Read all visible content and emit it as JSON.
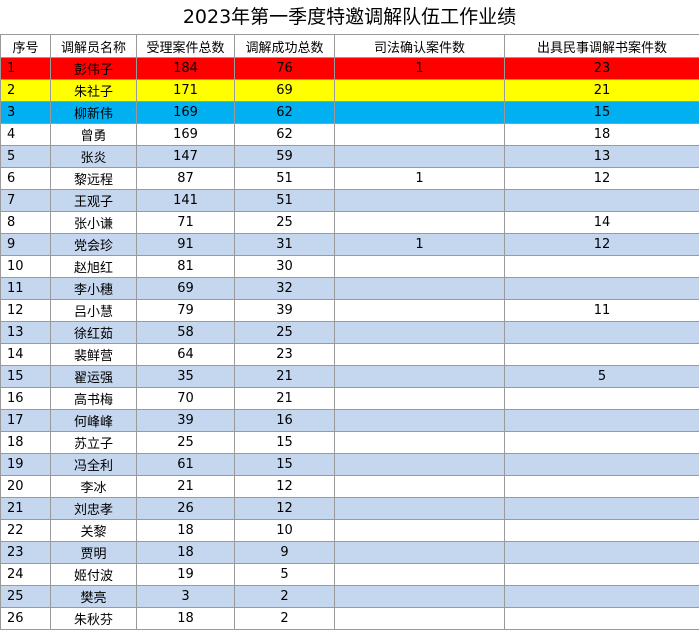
{
  "title": "2023年第一季度特邀调解队伍工作业绩",
  "colors": {
    "rank1": "#ff0000",
    "rank2": "#ffff00",
    "rank3": "#00b0f0",
    "band": "#c5d6ef",
    "plain": "#ffffff",
    "grid": "#9a9a9a"
  },
  "headers": [
    "序号",
    "调解员名称",
    "受理案件总数",
    "调解成功总数",
    "司法确认案件数",
    "出具民事调解书案件数"
  ],
  "rows": [
    {
      "no": "1",
      "name": "彭伟子",
      "accepted": "184",
      "success": "76",
      "judicial": "1",
      "documents": "23",
      "highlight": "rank1"
    },
    {
      "no": "2",
      "name": "朱社子",
      "accepted": "171",
      "success": "69",
      "judicial": "",
      "documents": "21",
      "highlight": "rank2"
    },
    {
      "no": "3",
      "name": "柳新伟",
      "accepted": "169",
      "success": "62",
      "judicial": "",
      "documents": "15",
      "highlight": "rank3"
    },
    {
      "no": "4",
      "name": "曾勇",
      "accepted": "169",
      "success": "62",
      "judicial": "",
      "documents": "18",
      "highlight": "plain"
    },
    {
      "no": "5",
      "name": "张炎",
      "accepted": "147",
      "success": "59",
      "judicial": "",
      "documents": "13",
      "highlight": "band"
    },
    {
      "no": "6",
      "name": "黎远程",
      "accepted": "87",
      "success": "51",
      "judicial": "1",
      "documents": "12",
      "highlight": "plain"
    },
    {
      "no": "7",
      "name": "王观子",
      "accepted": "141",
      "success": "51",
      "judicial": "",
      "documents": "",
      "highlight": "band"
    },
    {
      "no": "8",
      "name": "张小谦",
      "accepted": "71",
      "success": "25",
      "judicial": "",
      "documents": "14",
      "highlight": "plain"
    },
    {
      "no": "9",
      "name": "党会珍",
      "accepted": "91",
      "success": "31",
      "judicial": "1",
      "documents": "12",
      "highlight": "band"
    },
    {
      "no": "10",
      "name": "赵旭红",
      "accepted": "81",
      "success": "30",
      "judicial": "",
      "documents": "",
      "highlight": "plain"
    },
    {
      "no": "11",
      "name": "李小穗",
      "accepted": "69",
      "success": "32",
      "judicial": "",
      "documents": "",
      "highlight": "band"
    },
    {
      "no": "12",
      "name": "吕小慧",
      "accepted": "79",
      "success": "39",
      "judicial": "",
      "documents": "11",
      "highlight": "plain"
    },
    {
      "no": "13",
      "name": "徐红茹",
      "accepted": "58",
      "success": "25",
      "judicial": "",
      "documents": "",
      "highlight": "band"
    },
    {
      "no": "14",
      "name": "裴鲜营",
      "accepted": "64",
      "success": "23",
      "judicial": "",
      "documents": "",
      "highlight": "plain"
    },
    {
      "no": "15",
      "name": "翟运强",
      "accepted": "35",
      "success": "21",
      "judicial": "",
      "documents": "5",
      "highlight": "band"
    },
    {
      "no": "16",
      "name": "高书梅",
      "accepted": "70",
      "success": "21",
      "judicial": "",
      "documents": "",
      "highlight": "plain"
    },
    {
      "no": "17",
      "name": "何峰峰",
      "accepted": "39",
      "success": "16",
      "judicial": "",
      "documents": "",
      "highlight": "band"
    },
    {
      "no": "18",
      "name": "苏立子",
      "accepted": "25",
      "success": "15",
      "judicial": "",
      "documents": "",
      "highlight": "plain"
    },
    {
      "no": "19",
      "name": "冯全利",
      "accepted": "61",
      "success": "15",
      "judicial": "",
      "documents": "",
      "highlight": "band"
    },
    {
      "no": "20",
      "name": "李冰",
      "accepted": "21",
      "success": "12",
      "judicial": "",
      "documents": "",
      "highlight": "plain"
    },
    {
      "no": "21",
      "name": "刘忠孝",
      "accepted": "26",
      "success": "12",
      "judicial": "",
      "documents": "",
      "highlight": "band"
    },
    {
      "no": "22",
      "name": "关黎",
      "accepted": "18",
      "success": "10",
      "judicial": "",
      "documents": "",
      "highlight": "plain"
    },
    {
      "no": "23",
      "name": "贾明",
      "accepted": "18",
      "success": "9",
      "judicial": "",
      "documents": "",
      "highlight": "band"
    },
    {
      "no": "24",
      "name": "姬付波",
      "accepted": "19",
      "success": "5",
      "judicial": "",
      "documents": "",
      "highlight": "plain"
    },
    {
      "no": "25",
      "name": "樊亮",
      "accepted": "3",
      "success": "2",
      "judicial": "",
      "documents": "",
      "highlight": "band"
    },
    {
      "no": "26",
      "name": "朱秋芬",
      "accepted": "18",
      "success": "2",
      "judicial": "",
      "documents": "",
      "highlight": "plain"
    }
  ]
}
